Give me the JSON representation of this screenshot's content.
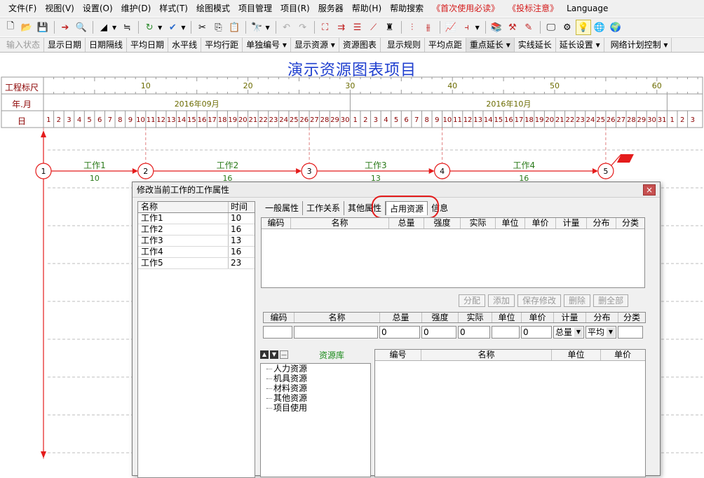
{
  "menu": [
    "文件(F)",
    "视图(V)",
    "设置(O)",
    "维护(D)",
    "样式(T)",
    "绘图模式",
    "项目管理",
    "项目(R)",
    "服务器",
    "帮助(H)",
    "帮助搜索",
    "《首次使用必读》",
    "《投标注意》",
    "Language"
  ],
  "toolbar2": [
    "输入状态",
    "显示日期",
    "日期隔线",
    "平均日期",
    "水平线",
    "平均行距",
    "单独编号",
    "显示资源",
    "资源图表",
    "显示规则",
    "平均点距",
    "重点延长",
    "实线延长",
    "延长设置",
    "网络计划控制"
  ],
  "chart": {
    "title": "演示资源图表项目",
    "ruler_label": "工程标尺",
    "month_label": "年.月",
    "day_label": "日",
    "scale_numbers": [
      "10",
      "20",
      "30",
      "40",
      "50",
      "60"
    ],
    "months": [
      "2016年09月",
      "2016年10月"
    ],
    "days_sep": [
      "1",
      "2",
      "3",
      "4",
      "5",
      "6",
      "7",
      "8",
      "9",
      "10",
      "11",
      "12",
      "13",
      "14",
      "15",
      "16",
      "17",
      "18",
      "19",
      "20",
      "21",
      "22",
      "23",
      "24",
      "25",
      "26",
      "27",
      "28",
      "29",
      "30"
    ],
    "days_oct": [
      "1",
      "2",
      "3",
      "4",
      "5",
      "6",
      "7",
      "8",
      "9",
      "10",
      "11",
      "12",
      "13",
      "14",
      "15",
      "16",
      "17",
      "18",
      "19",
      "20",
      "21",
      "22",
      "23",
      "24",
      "25",
      "26",
      "27",
      "28",
      "29",
      "30",
      "31"
    ],
    "days_nov": [
      "1",
      "2",
      "3"
    ],
    "nodes": [
      "1",
      "2",
      "3",
      "4",
      "5"
    ],
    "tasks": [
      {
        "name": "工作1",
        "duration": "10"
      },
      {
        "name": "工作2",
        "duration": "16"
      },
      {
        "name": "工作3",
        "duration": "13"
      },
      {
        "name": "工作4",
        "duration": "16"
      }
    ],
    "accent_red": "#e41c1c",
    "title_blue": "#1f3fcf"
  },
  "dialog": {
    "title": "修改当前工作的工作属性",
    "close": "×",
    "task_list_header": {
      "name": "名称",
      "time": "时间"
    },
    "task_list": [
      {
        "name": "工作1",
        "time": "10"
      },
      {
        "name": "工作2",
        "time": "16"
      },
      {
        "name": "工作3",
        "time": "13"
      },
      {
        "name": "工作4",
        "time": "16"
      },
      {
        "name": "工作5",
        "time": "23"
      }
    ],
    "tabs": [
      "一般属性",
      "工作关系",
      "其他属性",
      "占用资源",
      "信息"
    ],
    "selected_tab": "占用资源",
    "resource_table_headers": [
      "编码",
      "名称",
      "总量",
      "强度",
      "实际",
      "单位",
      "单价",
      "计量",
      "分布",
      "分类"
    ],
    "buttons": [
      "分配",
      "添加",
      "保存修改",
      "删除",
      "删全部"
    ],
    "input_headers": [
      "编码",
      "名称",
      "总量",
      "强度",
      "实际",
      "单位",
      "单价",
      "计量",
      "分布",
      "分类"
    ],
    "input_values": {
      "code": "",
      "name": "",
      "total": "0",
      "intensity": "0",
      "actual": "0",
      "unit": "",
      "price": "0",
      "measure": "总量",
      "distribution": "平均",
      "category": ""
    },
    "res_lib_title": "资源库",
    "res_tree": [
      "人力资源",
      "机具资源",
      "材料资源",
      "其他资源",
      "项目使用"
    ],
    "res_table_headers": [
      "编号",
      "名称",
      "单位",
      "单价"
    ]
  }
}
